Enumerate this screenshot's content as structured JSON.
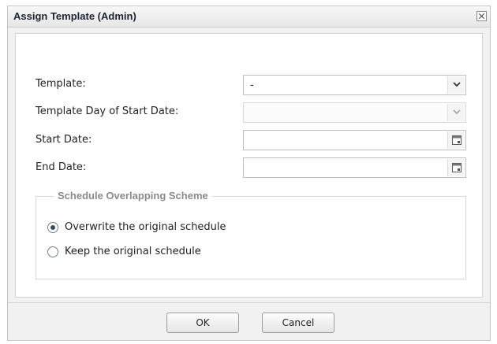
{
  "dialog": {
    "title": "Assign Template (Admin)"
  },
  "form": {
    "template_label": "Template:",
    "template_value": "-",
    "template_day_label": "Template Day of Start Date:",
    "template_day_value": "",
    "start_date_label": "Start Date:",
    "start_date_value": "",
    "end_date_label": "End Date:",
    "end_date_value": ""
  },
  "scheme": {
    "legend": "Schedule Overlapping Scheme",
    "options": [
      {
        "label": "Overwrite the original schedule",
        "selected": true
      },
      {
        "label": "Keep the original schedule",
        "selected": false
      }
    ]
  },
  "buttons": {
    "ok": "OK",
    "cancel": "Cancel"
  },
  "icons": {
    "close": "close-icon",
    "dropdown": "chevron-down-icon",
    "calendar": "calendar-icon"
  }
}
